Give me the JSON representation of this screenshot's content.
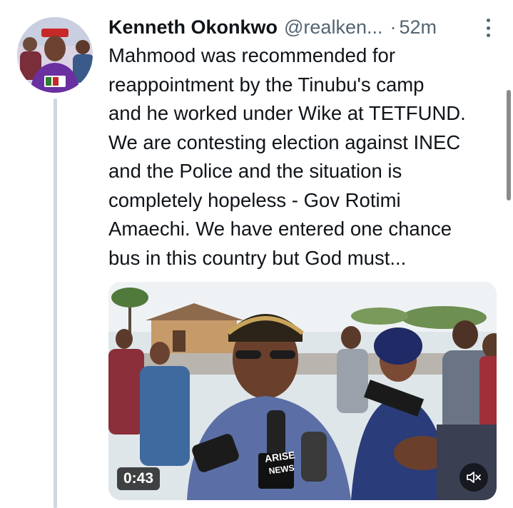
{
  "tweet": {
    "author_name": "Kenneth Okonkwo",
    "author_handle": "@realken...",
    "separator": "·",
    "timestamp": "52m",
    "text_lines": [
      "Mahmood was recommended for",
      "reappointment by the Tinubu's camp",
      "and he worked under Wike at TETFUND.",
      "We are contesting election against INEC",
      "and the Police and the situation is",
      "completely hopeless - Gov Rotimi",
      "Amaechi. We have entered one chance",
      "bus in this country but God must..."
    ],
    "avatar_icon": "profile-photo",
    "more_icon": "vertical-ellipsis-icon"
  },
  "video": {
    "duration": "0:43",
    "mic_logo_line1": "ARISE",
    "mic_logo_line2": "NEWS",
    "volume_icon": "speaker-muted-icon"
  },
  "colors": {
    "text_primary": "#0f1419",
    "text_secondary": "#536471",
    "thread_line": "#cfd9de"
  }
}
